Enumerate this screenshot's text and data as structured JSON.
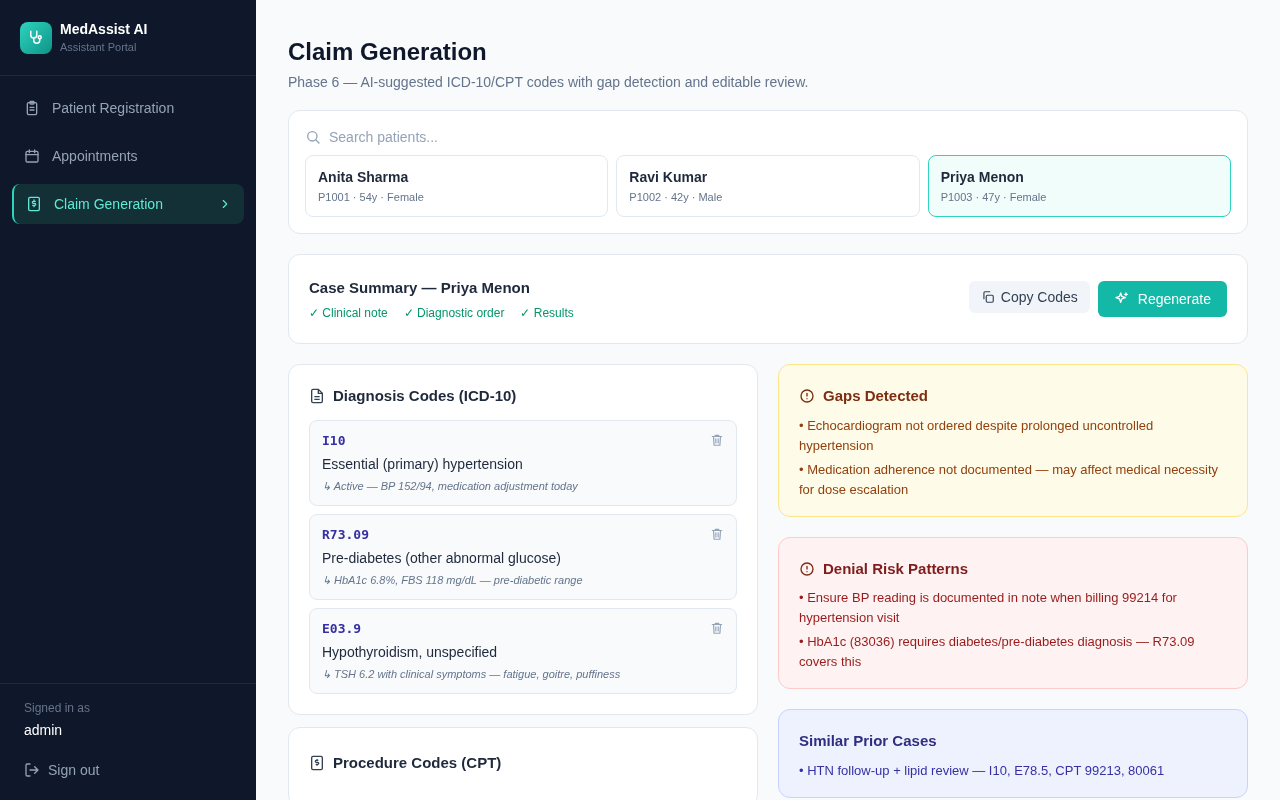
{
  "app": {
    "name": "MedAssist AI",
    "subtitle": "Assistant Portal"
  },
  "nav": [
    {
      "label": "Patient Registration",
      "selected": false
    },
    {
      "label": "Appointments",
      "selected": false
    },
    {
      "label": "Claim Generation",
      "selected": true
    }
  ],
  "user": {
    "caption": "Signed in as",
    "name": "admin",
    "signout": "Sign out"
  },
  "page": {
    "title": "Claim Generation",
    "subtitle": "Phase 6 — AI-suggested ICD-10/CPT codes with gap detection and editable review."
  },
  "search": {
    "placeholder": "Search patients..."
  },
  "patients": [
    {
      "name": "Anita Sharma",
      "meta": "P1001 · 54y · Female",
      "selected": false
    },
    {
      "name": "Ravi Kumar",
      "meta": "P1002 · 42y · Male",
      "selected": false
    },
    {
      "name": "Priya Menon",
      "meta": "P1003 · 47y · Female",
      "selected": true
    }
  ],
  "summary": {
    "title": "Case Summary — Priya Menon",
    "checks": [
      "✓ Clinical note",
      "✓ Diagnostic order",
      "✓ Results"
    ],
    "copy_button": "Copy Codes",
    "regenerate_button": "Regenerate"
  },
  "diagnosis": {
    "title": "Diagnosis Codes (ICD-10)",
    "codes": [
      {
        "code": "I10",
        "description": "Essential (primary) hypertension",
        "note": "↳ Active — BP 152/94, medication adjustment today"
      },
      {
        "code": "R73.09",
        "description": "Pre-diabetes (other abnormal glucose)",
        "note": "↳ HbA1c 6.8%, FBS 118 mg/dL — pre-diabetic range"
      },
      {
        "code": "E03.9",
        "description": "Hypothyroidism, unspecified",
        "note": "↳ TSH 6.2 with clinical symptoms — fatigue, goitre, puffiness"
      }
    ]
  },
  "procedures": {
    "title": "Procedure Codes (CPT)"
  },
  "panels": [
    {
      "kind": "gaps",
      "title": "Gaps Detected",
      "items": [
        "• Echocardiogram not ordered despite prolonged uncontrolled hypertension",
        "• Medication adherence not documented — may affect medical necessity for dose escalation"
      ]
    },
    {
      "kind": "denial",
      "title": "Denial Risk Patterns",
      "items": [
        "• Ensure BP reading is documented in note when billing 99214 for hypertension visit",
        "• HbA1c (83036) requires diabetes/pre-diabetes diagnosis — R73.09 covers this"
      ]
    },
    {
      "kind": "similar",
      "title": "Similar Prior Cases",
      "items": [
        "• HTN follow-up + lipid review — I10, E78.5, CPT 99213, 80061"
      ]
    }
  ]
}
